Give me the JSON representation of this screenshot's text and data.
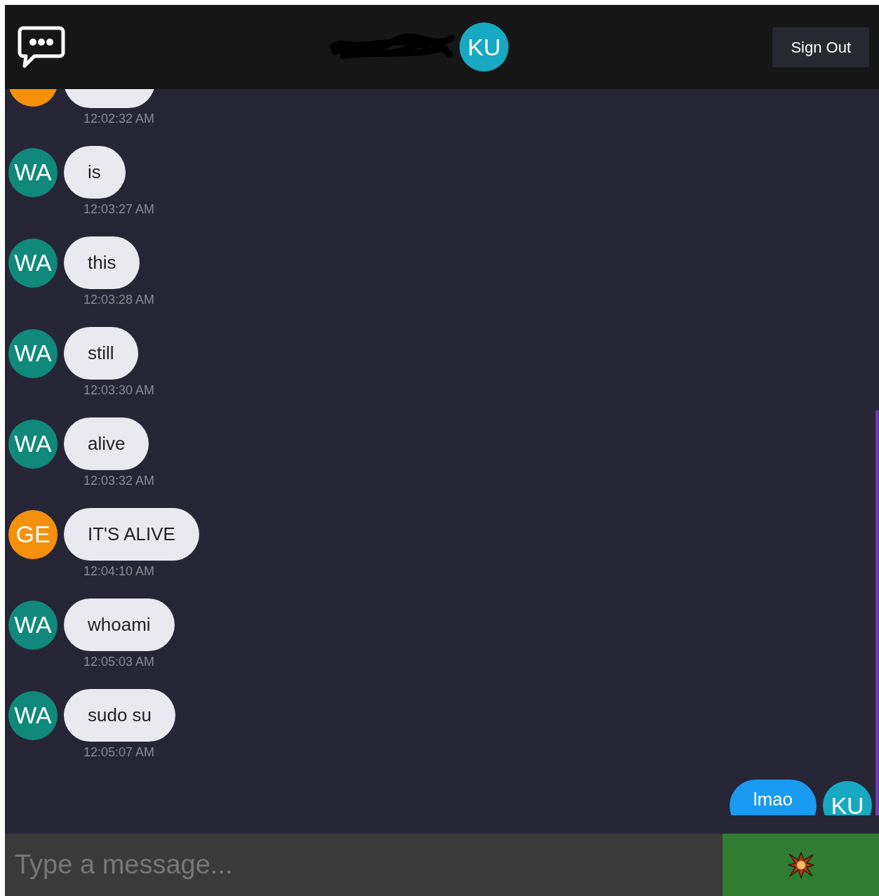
{
  "header": {
    "user_initials": "KU",
    "sign_out": "Sign Out"
  },
  "messages": [
    {
      "own": false,
      "color": "#f5900c",
      "time": "12:02:32 AM"
    },
    {
      "own": false,
      "initials": "WA",
      "color": "#10897a",
      "text": "is",
      "time": "12:03:27 AM"
    },
    {
      "own": false,
      "initials": "WA",
      "color": "#10897a",
      "text": "this",
      "time": "12:03:28 AM"
    },
    {
      "own": false,
      "initials": "WA",
      "color": "#10897a",
      "text": "still",
      "time": "12:03:30 AM"
    },
    {
      "own": false,
      "initials": "WA",
      "color": "#10897a",
      "text": "alive",
      "time": "12:03:32 AM"
    },
    {
      "own": false,
      "initials": "GE",
      "color": "#f5900c",
      "text": "IT'S ALIVE",
      "time": "12:04:10 AM"
    },
    {
      "own": false,
      "initials": "WA",
      "color": "#10897a",
      "text": "whoami",
      "time": "12:05:03 AM"
    },
    {
      "own": false,
      "initials": "WA",
      "color": "#10897a",
      "text": "sudo su",
      "time": "12:05:07 AM"
    },
    {
      "own": true,
      "initials": "KU",
      "color": "#17a9c1",
      "text": "lmao"
    }
  ],
  "composer": {
    "placeholder": "Type a message..."
  }
}
